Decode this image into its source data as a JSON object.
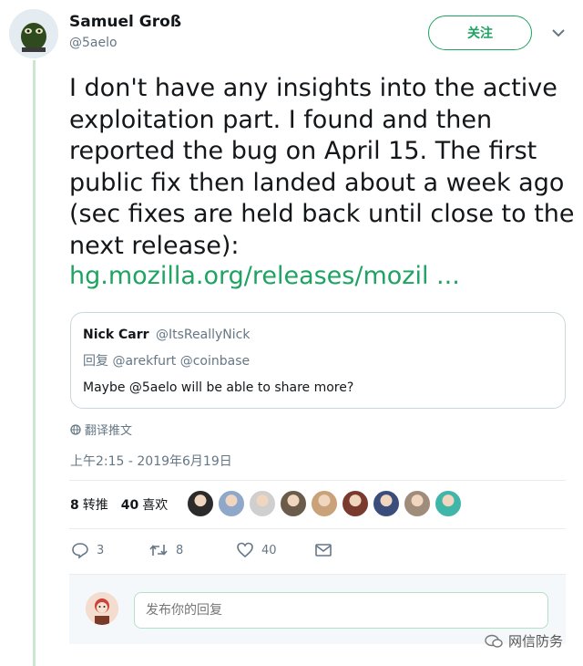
{
  "author": {
    "name": "Samuel Groß",
    "handle": "@5aelo",
    "follow_label": "关注"
  },
  "tweet": {
    "lines": [
      "I don't have any insights into the active",
      "exploitation part. I found and then",
      "reported the bug on April 15. The first",
      "public fix then landed about a week ago",
      "(sec fixes are held back until close to the",
      "next release):"
    ],
    "link_text": "hg.mozilla.org/releases/mozil  ..."
  },
  "quote": {
    "name": "Nick Carr",
    "handle": "@ItsReallyNick",
    "reply_prefix": "回复",
    "reply_targets": "@arekfurt @coinbase",
    "body": "Maybe @5aelo will be able to share more?"
  },
  "translate_label": "翻译推文",
  "timestamp": "上午2:15 - 2019年6月19日",
  "stats": {
    "retweets_count": "8",
    "retweets_label": "转推",
    "likes_count": "40",
    "likes_label": "喜欢"
  },
  "likers": [
    "#2b2b2b",
    "#8fa7c8",
    "#cfcfcf",
    "#6b5b4a",
    "#c9a27a",
    "#7a3b2e",
    "#3b4d7a",
    "#a08c7a",
    "#3fb6a8"
  ],
  "actions": {
    "reply_count": "3",
    "retweet_count": "8",
    "like_count": "40"
  },
  "reply_placeholder": "发布你的回复",
  "watermark": "网信防务",
  "colors": {
    "accent": "#1ea362",
    "muted": "#657786"
  }
}
